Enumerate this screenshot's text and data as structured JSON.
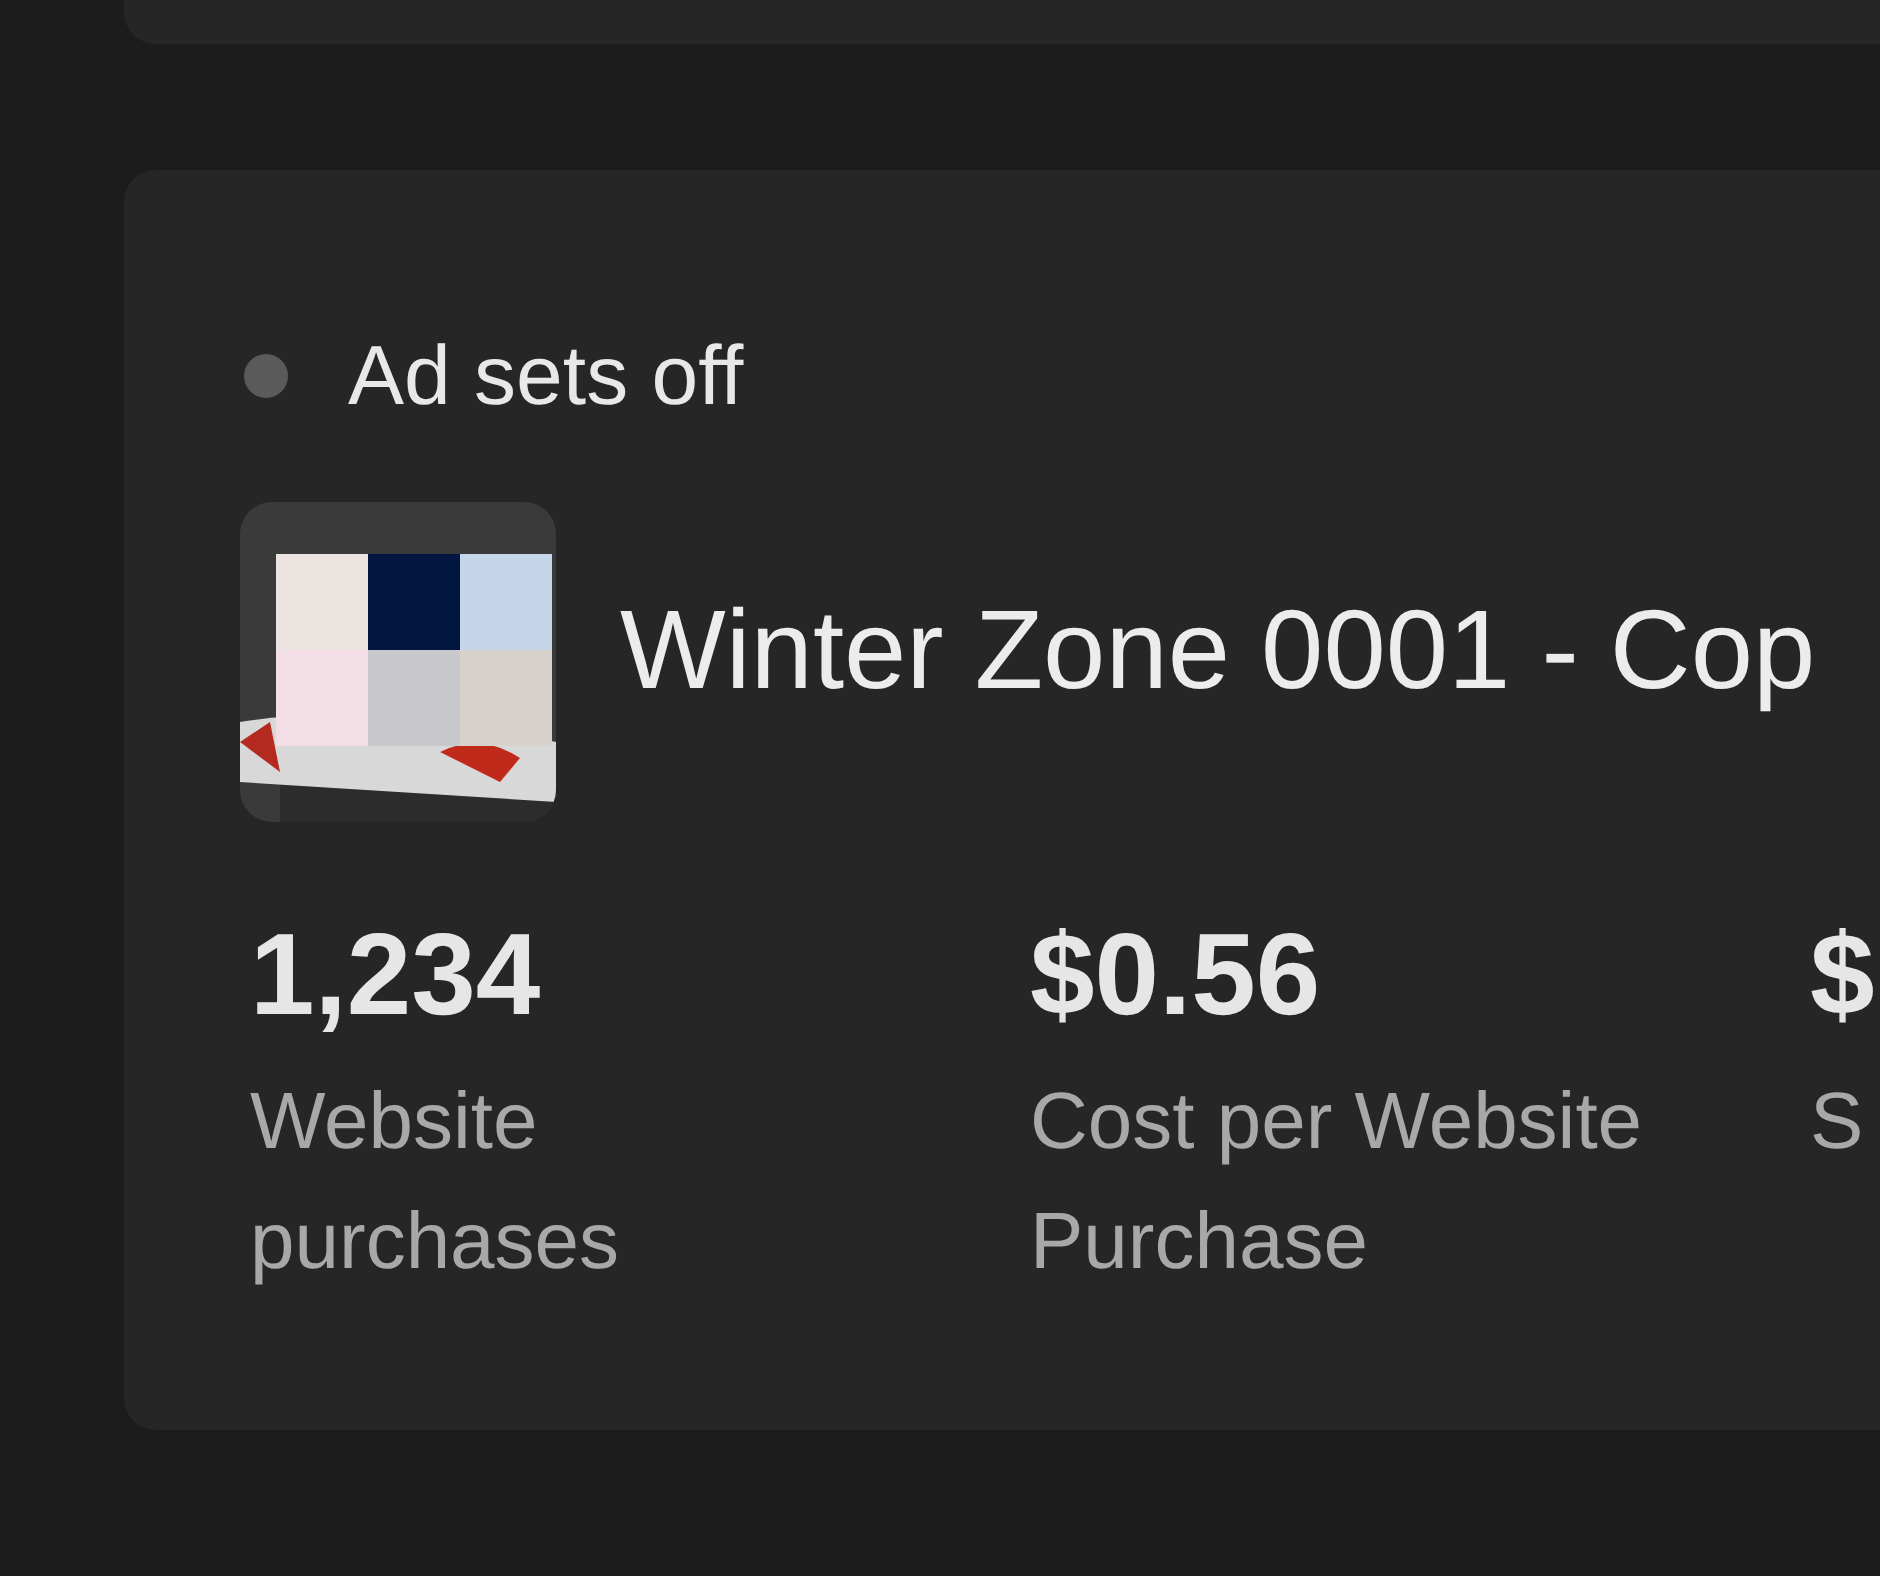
{
  "ad_set": {
    "status": {
      "label": "Ad sets off",
      "color": "#5a5a5a"
    },
    "title": "Winter Zone 0001 - Cop",
    "metrics": [
      {
        "value": "1,234",
        "label": "Website purchases"
      },
      {
        "value": "$0.56",
        "label": "Cost per Website Purchase"
      },
      {
        "value": "$",
        "label": "S"
      }
    ]
  }
}
